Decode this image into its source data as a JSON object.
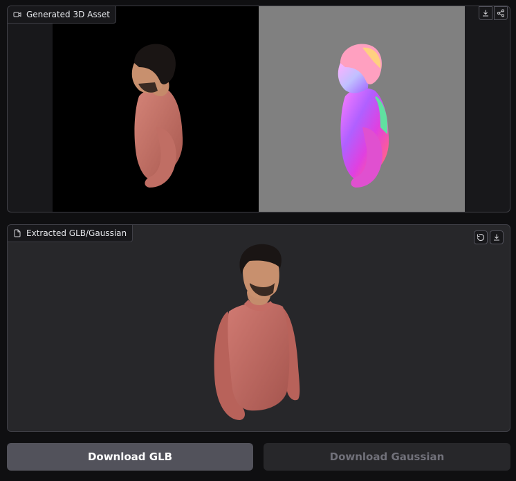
{
  "panel1": {
    "label": "Generated 3D Asset",
    "label_icon": "video-icon",
    "actions": [
      "download-icon",
      "share-icon"
    ],
    "views": [
      "rgb-render",
      "normal-map-render"
    ]
  },
  "panel2": {
    "label": "Extracted GLB/Gaussian",
    "label_icon": "file-icon",
    "actions": [
      "reset-icon",
      "download-icon"
    ]
  },
  "buttons": {
    "download_glb": "Download GLB",
    "download_gaussian": "Download Gaussian"
  },
  "colors": {
    "background": "#0f0f11",
    "panel": "#18181b",
    "primary_button": "#52525b",
    "disabled_button": "#27272a",
    "normal_map_bg": "#808080"
  }
}
